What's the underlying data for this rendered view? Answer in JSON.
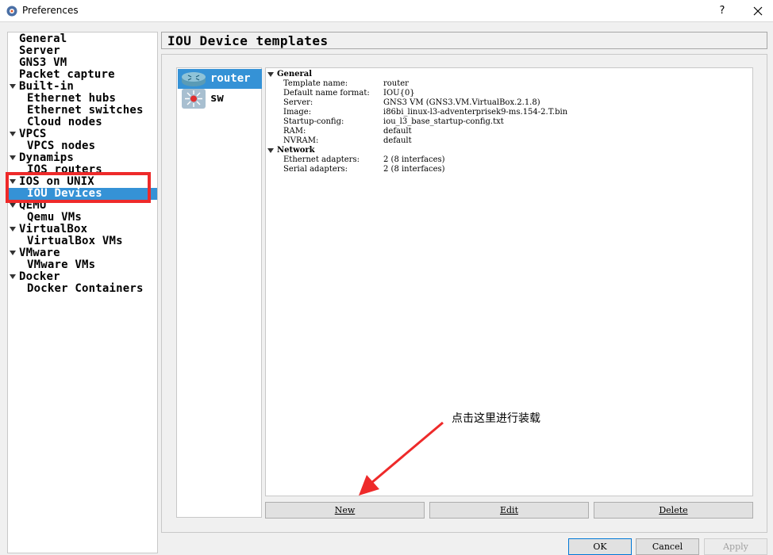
{
  "window": {
    "title": "Preferences",
    "help_label": "?",
    "icon": "gns3-app-icon"
  },
  "tree": {
    "items": [
      {
        "label": "General",
        "level": 0,
        "expanded": null
      },
      {
        "label": "Server",
        "level": 0,
        "expanded": null
      },
      {
        "label": "GNS3 VM",
        "level": 0,
        "expanded": null
      },
      {
        "label": "Packet capture",
        "level": 0,
        "expanded": null
      },
      {
        "label": "Built-in",
        "level": 0,
        "expanded": true
      },
      {
        "label": "Ethernet hubs",
        "level": 1,
        "expanded": null
      },
      {
        "label": "Ethernet switches",
        "level": 1,
        "expanded": null
      },
      {
        "label": "Cloud nodes",
        "level": 1,
        "expanded": null
      },
      {
        "label": "VPCS",
        "level": 0,
        "expanded": true
      },
      {
        "label": "VPCS nodes",
        "level": 1,
        "expanded": null
      },
      {
        "label": "Dynamips",
        "level": 0,
        "expanded": true
      },
      {
        "label": "IOS routers",
        "level": 1,
        "expanded": null
      },
      {
        "label": "IOS on UNIX",
        "level": 0,
        "expanded": true
      },
      {
        "label": "IOU Devices",
        "level": 1,
        "expanded": null,
        "selected": true
      },
      {
        "label": "QEMU",
        "level": 0,
        "expanded": true
      },
      {
        "label": "Qemu VMs",
        "level": 1,
        "expanded": null
      },
      {
        "label": "VirtualBox",
        "level": 0,
        "expanded": true
      },
      {
        "label": "VirtualBox VMs",
        "level": 1,
        "expanded": null
      },
      {
        "label": "VMware",
        "level": 0,
        "expanded": true
      },
      {
        "label": "VMware VMs",
        "level": 1,
        "expanded": null
      },
      {
        "label": "Docker",
        "level": 0,
        "expanded": true
      },
      {
        "label": "Docker Containers",
        "level": 1,
        "expanded": null
      }
    ]
  },
  "page": {
    "title": "IOU Device templates"
  },
  "templates": [
    {
      "name": "router",
      "icon": "router-icon",
      "selected": true
    },
    {
      "name": "sw",
      "icon": "switch-icon",
      "selected": false
    }
  ],
  "info": {
    "general_label": "General",
    "general_rows": [
      {
        "key": "Template name:",
        "value": "router"
      },
      {
        "key": "Default name format:",
        "value": "IOU{0}"
      },
      {
        "key": "Server:",
        "value": "GNS3 VM (GNS3.VM.VirtualBox.2.1.8)"
      },
      {
        "key": "Image:",
        "value": "i86bi_linux-l3-adventerprisek9-ms.154-2.T.bin"
      },
      {
        "key": "Startup-config:",
        "value": "iou_l3_base_startup-config.txt"
      },
      {
        "key": "RAM:",
        "value": "default"
      },
      {
        "key": "NVRAM:",
        "value": "default"
      }
    ],
    "network_label": "Network",
    "network_rows": [
      {
        "key": "Ethernet adapters:",
        "value": "2 (8 interfaces)"
      },
      {
        "key": "Serial adapters:",
        "value": "2 (8 interfaces)"
      }
    ]
  },
  "actions": {
    "new_label": "New",
    "edit_label": "Edit",
    "delete_label": "Delete"
  },
  "annotation": {
    "text": "点击这里进行装载",
    "highlight_color": "#ee2a2a"
  },
  "dialog_buttons": {
    "ok_label": "OK",
    "cancel_label": "Cancel",
    "apply_label": "Apply"
  },
  "colors": {
    "selection": "#3592d6",
    "annotation_red": "#ee2a2a"
  }
}
